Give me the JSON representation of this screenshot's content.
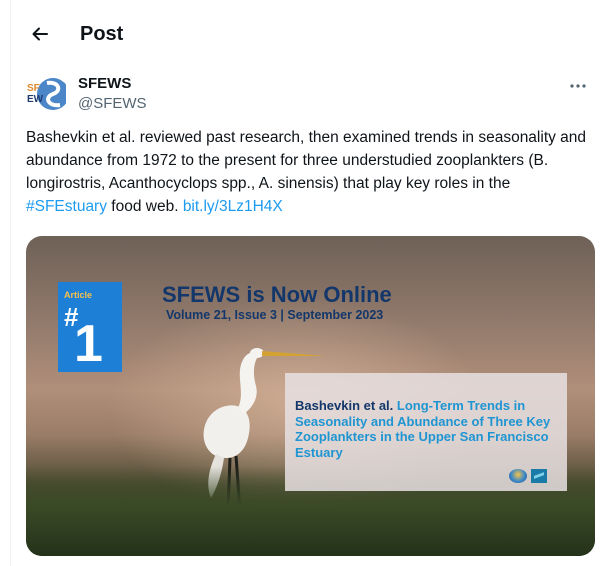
{
  "header": {
    "title": "Post"
  },
  "author": {
    "name": "SFEWS",
    "handle": "@SFEWS",
    "avatar_text": "SF EW"
  },
  "tweet": {
    "text_before": "Bashevkin et al. reviewed past research, then examined trends in seasonality and abundance from 1972 to the present for three understudied zooplankters (B. longirostris, Acanthocyclops spp., A. sinensis) that play key roles in the ",
    "hashtag": "#SFEstuary",
    "text_after": " food web. ",
    "link": "bit.ly/3Lz1H4X"
  },
  "media": {
    "badge_label": "Article",
    "badge_hash": "#",
    "badge_number": "1",
    "title": "SFEWS is Now Online",
    "subtitle": "Volume 21, Issue 3 | September 2023",
    "article_authors": "Bashevkin et al.",
    "article_title": "Long-Term Trends in Seasonality and Abundance of Three Key Zooplankters in the Upper San Francisco Estuary"
  },
  "icons": {
    "back": "arrow-left-icon",
    "more": "more-horizontal-icon"
  },
  "colors": {
    "link": "#1d9bf0",
    "secondary_text": "#536471",
    "banner_navy": "#13376a",
    "banner_highlight": "#1f95d2",
    "badge_blue": "#1d7fd6"
  }
}
